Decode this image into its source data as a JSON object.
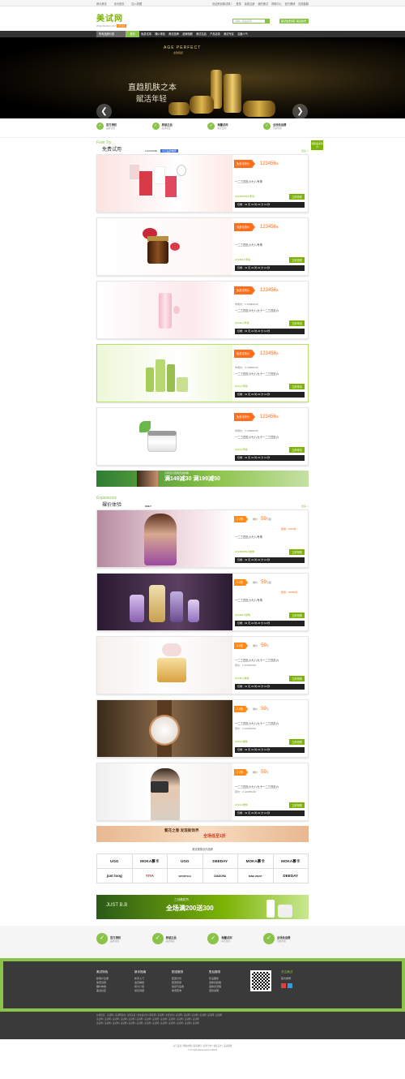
{
  "topbar": {
    "left": [
      "我与美试",
      "设为首页",
      "加入收藏"
    ],
    "right": [
      "欢迎来到美试网！",
      "登录",
      "免费注册",
      "我的美试",
      "帮助中心",
      "官方微博",
      "在线客服"
    ]
  },
  "header": {
    "logo": "美试网",
    "logo_sub": "WWW.MEISHI.COM",
    "logo_badge": "免费试用",
    "search_placeholder": "请输入商品名称",
    "btn1": "美试免费领取",
    "btn2": "美试免费试用"
  },
  "nav": {
    "category": "所有品牌分类",
    "items": [
      "首页",
      "免费试用",
      "裸价体验",
      "美试品牌",
      "品牌旗舰",
      "美试名品",
      "产品目录",
      "美试专区",
      "名媛人气"
    ]
  },
  "banner": {
    "line1": "直趋肌肤之本",
    "line2": "赋活年轻",
    "brand": "AGE PERFECT",
    "brand_sub": "金致臻颜",
    "prev": "❮",
    "next": "❯"
  },
  "features": [
    {
      "icon": "✓",
      "a": "官方授权",
      "b": "品牌直供"
    },
    {
      "icon": "✓",
      "a": "原装正品",
      "b": "品质保证"
    },
    {
      "icon": "✓",
      "a": "海量试用",
      "b": "每天更新"
    },
    {
      "icon": "✓",
      "a": "全场免运费",
      "b": "包邮到家"
    }
  ],
  "free": {
    "en": "Free Try",
    "cn": "免费试用",
    "more": "更多>>",
    "brands": [
      "LANCOME",
      "今日品牌推荐"
    ],
    "side": "领取美试积分"
  },
  "free_items": [
    {
      "tag": "免费试用价",
      "price": "123456",
      "unit": "件",
      "name": "一二三四五六七八专场",
      "count": "123456789人申请",
      "apply": "立即查看",
      "timer": "仅剩：01 天 21 时 22 分 12 秒"
    },
    {
      "tag": "免费试用价",
      "price": "123456",
      "unit": "件",
      "name": "一二三四五六七八专场",
      "count": "123456人申请",
      "apply": "立即查看",
      "timer": "仅剩：01 天 21 时 22 分 12 秒"
    },
    {
      "tag": "免费试用价",
      "price": "123456",
      "unit": "件",
      "line1": "市场价：¥ 139999.00",
      "line2": "一二三四五六七八九十一二三四五六",
      "count": "12345人申请",
      "apply": "立即申请",
      "timer": "仅剩：01 天 21 时 22 分 12 秒"
    },
    {
      "tag": "免费试用价",
      "price": "123456",
      "unit": "件",
      "line1": "市场价：¥ 139999.00",
      "line2": "一二三四五六七八九十一二三四五六",
      "count": "1234人申请",
      "apply": "立即申请",
      "timer": "仅剩：01 天 21 时 22 分 12 秒"
    },
    {
      "tag": "免费试用价",
      "price": "123456",
      "unit": "件",
      "line1": "市场价：¥ 139999.00",
      "line2": "一二三四五六七八九十一二三四五六",
      "count": "1234人申请",
      "apply": "立即申请",
      "timer": "仅剩：01 天 21 时 22 分 12 秒"
    }
  ],
  "ad1": {
    "small": "只有百分百纯天然护肤",
    "big": "满149减30  满199减50"
  },
  "exp": {
    "en": "Experience",
    "cn": "裸价体验",
    "brand": "ONLY",
    "more": "更多>>"
  },
  "exp_items": [
    {
      "disc": "2.2折",
      "label": "爆价",
      "price": "59",
      "unit": "元起",
      "name": "一二三四五六七八专场",
      "count": "123456789人抢购",
      "apply": "立即抢购",
      "timer": "仅剩：01 天 21 时 22 分 12 秒",
      "extra": "数量：1000件"
    },
    {
      "disc": "2.2折",
      "label": "爆价",
      "price": "59",
      "unit": "元起",
      "name": "一二三四五六七八专场",
      "count": "123456人抢购",
      "apply": "立即抢购",
      "timer": "仅剩：01 天 21 时 22 分 12 秒",
      "extra": "数量：99999件"
    },
    {
      "disc": "2.2折",
      "label": "爆价",
      "price": "59",
      "unit": "元",
      "line1": "一二三四五六七八九十一二三四五六",
      "line2": "原价：¥ 123456.00",
      "count": "12345人抢购",
      "apply": "立即抢购",
      "timer": "仅剩：01 天 21 时 22 分 12 秒"
    },
    {
      "disc": "2.2折",
      "label": "爆价",
      "price": "59",
      "unit": "元",
      "line1": "一二三四五六七八九十一二三四五六",
      "line2": "原价：¥ 123456.00",
      "count": "1234人抢购",
      "apply": "立即抢购",
      "timer": "仅剩：01 天 21 时 22 分 12 秒"
    },
    {
      "disc": "2.2折",
      "label": "爆价",
      "price": "59",
      "unit": "元",
      "line1": "一二三四五六七八九十一二三四五六",
      "line2": "原价：¥ 123456.00",
      "count": "1234人抢购",
      "apply": "立即抢购",
      "timer": "仅剩：01 天 21 时 22 分 12 秒"
    }
  ],
  "ad2": {
    "a": "繁花之春 发现新饰界",
    "b": "全场低至1折"
  },
  "partners": {
    "title": "美试美丽合作品牌",
    "list": [
      "UGG",
      "MOKA慕卡",
      "UGG",
      "DEEDAY",
      "MOKA慕卡",
      "MOKA慕卡",
      "just long",
      "YIYA",
      "SPORTICA",
      "DIADORA",
      "NINE WEST",
      "DEEDAY"
    ]
  },
  "ad3": {
    "brand": "JUST B.B",
    "small": "三月棉花节",
    "big": "全场满200送300"
  },
  "footer": {
    "cols": [
      {
        "h": "美试特色",
        "items": [
          "新用户注册",
          "免费试用",
          "裸价体验",
          "美试社区"
        ]
      },
      {
        "h": "新手指南",
        "items": [
          "新手入门",
          "会员等级",
          "积分介绍",
          "常见问题"
        ]
      },
      {
        "h": "配送服务",
        "items": [
          "配送方式",
          "配送费用",
          "验货与签收",
          "物流查询"
        ]
      },
      {
        "h": "售后服务",
        "items": [
          "售后服务",
          "退换货政策",
          "退换货流程",
          "退款说明"
        ]
      }
    ],
    "follow": "关注美试",
    "follow_sub": "官方微博",
    "links": [
      "友情链接：美试网 | 美试网试用 | 美容美发 | 化妆品试用 | 服装网 | 美试网 | 免费试用 | 美试网 | 美试网 | 美试网 | 美试网 | 美试网 | 美试网",
      "美试网 | 美试网 | 美试网 | 美试网 | 美试网 | 美试网 | 美试网 | 美试网 | 美试网 | 美试网 | 美试网 | 美试网 | 美试网",
      "美试网 | 美试网 | 美试网 | 美试网 | 美试网 | 美试网 | 美试网 | 美试网 | 美试网 | 美试网 | 美试网 | 美试网 | 美试网"
    ],
    "bottom": "关于美试 | 网站地图 | 联系我们 | 商务合作 | 诚征英才 | 美试联盟",
    "copyright": "© All rights Reserved by Meishi"
  },
  "colors": {
    "green": "#8bc34a",
    "orange": "#ff6e1a",
    "dark": "#333333"
  }
}
